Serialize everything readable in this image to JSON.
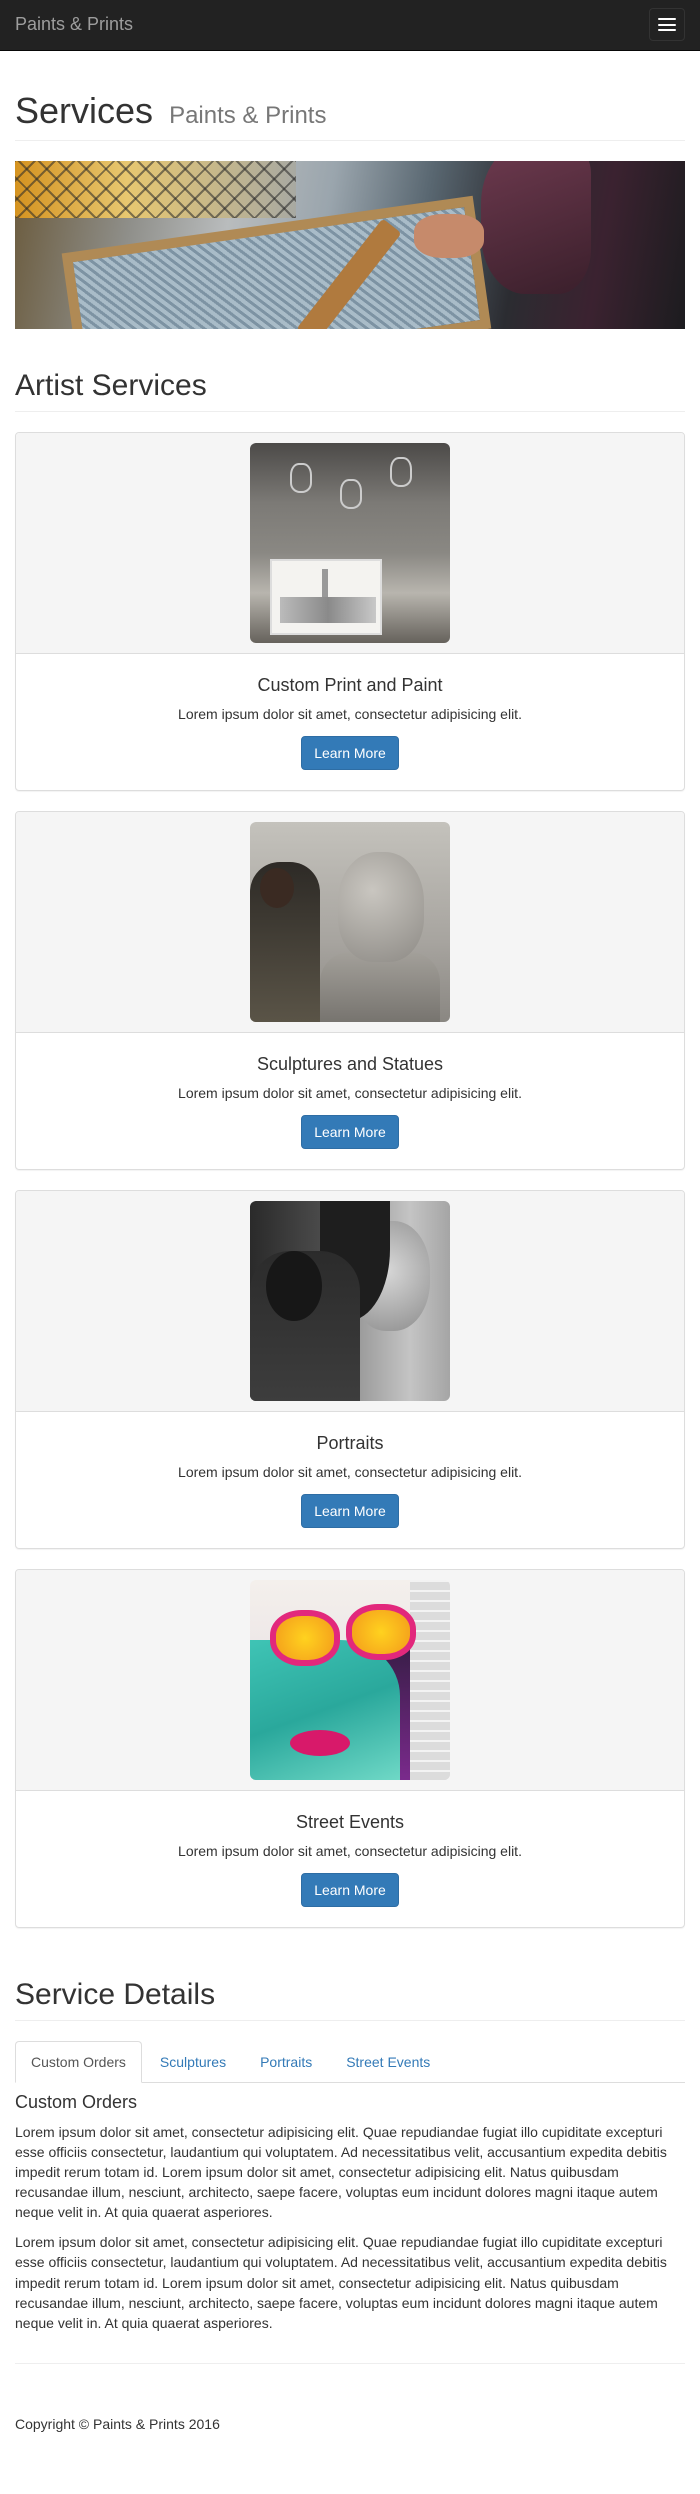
{
  "nav": {
    "brand": "Paints & Prints",
    "toggle_icon": "hamburger-menu-icon"
  },
  "header": {
    "title": "Services",
    "subtitle": "Paints & Prints"
  },
  "artist_services": {
    "title": "Artist Services",
    "cards": [
      {
        "title": "Custom Print and Paint",
        "text": "Lorem ipsum dolor sit amet, consectetur adipisicing elit.",
        "button": "Learn More"
      },
      {
        "title": "Sculptures and Statues",
        "text": "Lorem ipsum dolor sit amet, consectetur adipisicing elit.",
        "button": "Learn More"
      },
      {
        "title": "Portraits",
        "text": "Lorem ipsum dolor sit amet, consectetur adipisicing elit.",
        "button": "Learn More"
      },
      {
        "title": "Street Events",
        "text": "Lorem ipsum dolor sit amet, consectetur adipisicing elit.",
        "button": "Learn More"
      }
    ]
  },
  "service_details": {
    "title": "Service Details",
    "tabs": [
      "Custom Orders",
      "Sculptures",
      "Portraits",
      "Street Events"
    ],
    "active_tab": "Custom Orders",
    "content_title": "Custom Orders",
    "paragraphs": [
      "Lorem ipsum dolor sit amet, consectetur adipisicing elit. Quae repudiandae fugiat illo cupiditate excepturi esse officiis consectetur, laudantium qui voluptatem. Ad necessitatibus velit, accusantium expedita debitis impedit rerum totam id. Lorem ipsum dolor sit amet, consectetur adipisicing elit. Natus quibusdam recusandae illum, nesciunt, architecto, saepe facere, voluptas eum incidunt dolores magni itaque autem neque velit in. At quia quaerat asperiores.",
      "Lorem ipsum dolor sit amet, consectetur adipisicing elit. Quae repudiandae fugiat illo cupiditate excepturi esse officiis consectetur, laudantium qui voluptatem. Ad necessitatibus velit, accusantium expedita debitis impedit rerum totam id. Lorem ipsum dolor sit amet, consectetur adipisicing elit. Natus quibusdam recusandae illum, nesciunt, architecto, saepe facere, voluptas eum incidunt dolores magni itaque autem neque velit in. At quia quaerat asperiores."
    ]
  },
  "footer": {
    "copyright": "Copyright © Paints & Prints 2016"
  },
  "colors": {
    "primary": "#337ab7",
    "navbar": "#222222",
    "text": "#333333"
  }
}
